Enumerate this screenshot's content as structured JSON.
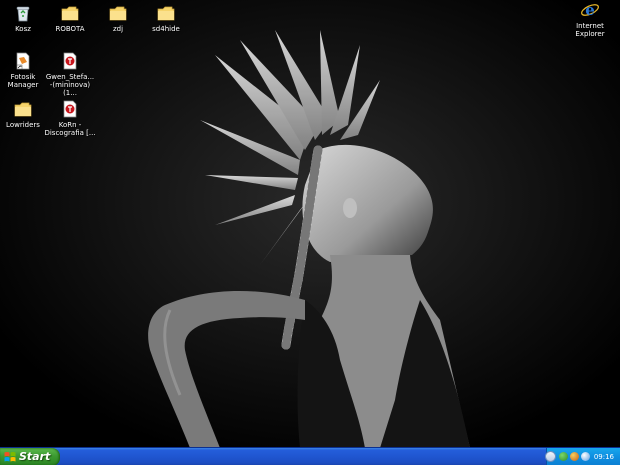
{
  "desktop": {
    "icons_left": [
      {
        "label": "Kosz",
        "icon": "recycle-bin-icon"
      },
      {
        "label": "ROBOTA",
        "icon": "folder-icon"
      },
      {
        "label": "zdj",
        "icon": "folder-icon"
      },
      {
        "label": "sd4hide",
        "icon": "folder-icon"
      },
      {
        "label": "Fotosik Manager",
        "icon": "fotosik-app-icon"
      },
      {
        "label": "Gwen_Stefa... -(mininova)(1...",
        "icon": "torrent-file-icon"
      },
      {
        "label": "Lowriders",
        "icon": "folder-icon"
      },
      {
        "label": "KoRn - Discografia [...",
        "icon": "torrent-file-icon"
      }
    ],
    "icons_right": [
      {
        "label": "Internet Explorer",
        "icon": "internet-explorer-icon"
      }
    ]
  },
  "taskbar": {
    "start_label": "Start",
    "tray_icons": [
      "tray-icon-1",
      "tray-icon-2",
      "tray-icon-3"
    ],
    "clock": "09:16"
  },
  "colors": {
    "taskbar_blue": "#245edb",
    "start_green": "#3c9a31",
    "tray_blue": "#0f8ee0"
  }
}
